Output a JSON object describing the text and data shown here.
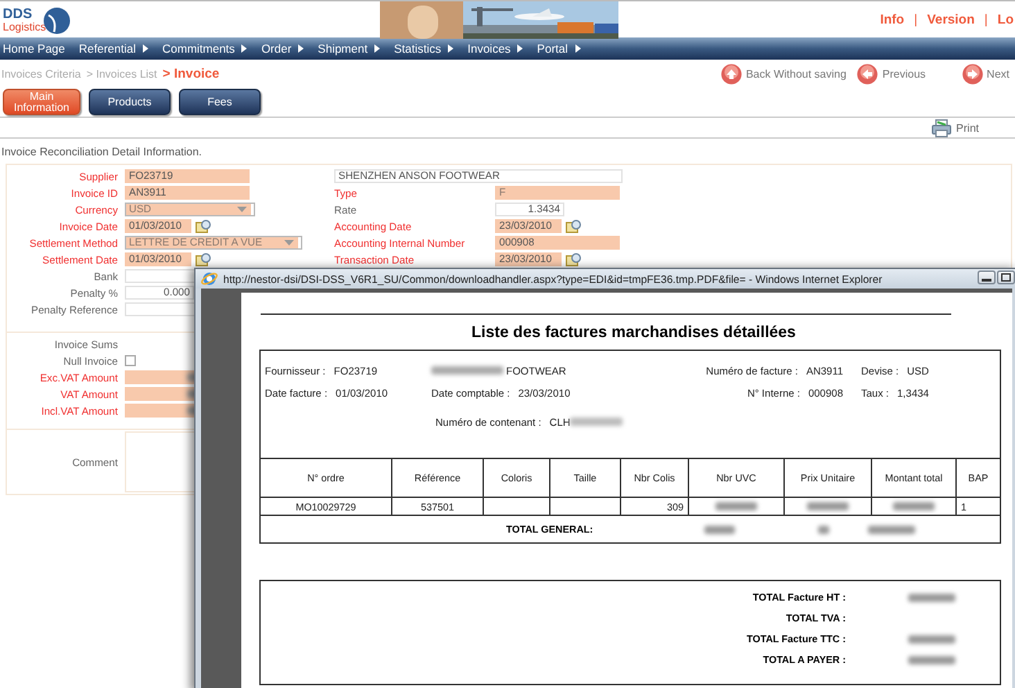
{
  "logo": {
    "title": "DDS",
    "subtitle": "Logistics"
  },
  "header_links": [
    {
      "kind": "link",
      "text": "Info"
    },
    {
      "kind": "separator",
      "text": "|"
    },
    {
      "kind": "link",
      "text": "Version"
    },
    {
      "kind": "separator",
      "text": "|"
    },
    {
      "kind": "link",
      "text": "Lo"
    }
  ],
  "nav": [
    {
      "label": "Home Page",
      "submenu": false
    },
    {
      "label": "Referential",
      "submenu": true
    },
    {
      "label": "Commitments",
      "submenu": true
    },
    {
      "label": "Order",
      "submenu": true
    },
    {
      "label": "Shipment",
      "submenu": true
    },
    {
      "label": "Statistics",
      "submenu": true
    },
    {
      "label": "Invoices",
      "submenu": true
    },
    {
      "label": "Portal",
      "submenu": true
    }
  ],
  "breadcrumb": [
    {
      "kind": "link",
      "text": "Invoices Criteria"
    },
    {
      "kind": "link",
      "text": "> Invoices List"
    },
    {
      "kind": "current",
      "text": "> Invoice"
    }
  ],
  "actions": [
    {
      "label": "Back Without saving",
      "kind": "up"
    },
    {
      "label": "Previous",
      "kind": "left"
    },
    {
      "label": "Next",
      "kind": "right"
    }
  ],
  "tabs": [
    {
      "label": "Main Information",
      "selected": true
    },
    {
      "label": "Products",
      "selected": false
    },
    {
      "label": "Fees",
      "selected": false
    }
  ],
  "toolbar": {
    "print": "Print"
  },
  "intro": "Invoice Reconciliation Detail Information.",
  "left_fields": [
    {
      "label": "Supplier",
      "required": true,
      "kind": "text",
      "value": "FO23719",
      "disabled": false
    },
    {
      "label": "Invoice ID",
      "required": true,
      "kind": "text",
      "value": "AN3911",
      "disabled": false
    },
    {
      "label": "Currency",
      "required": true,
      "kind": "select",
      "value": "USD",
      "disabled": true
    },
    {
      "label": "Invoice Date",
      "required": true,
      "kind": "date",
      "value": "01/03/2010",
      "disabled": false
    },
    {
      "label": "Settlement Method",
      "required": true,
      "kind": "select",
      "value": "LETTRE DE CREDIT A VUE",
      "disabled": true
    },
    {
      "label": "Settlement Date",
      "required": true,
      "kind": "date",
      "value": "01/03/2010",
      "disabled": false
    },
    {
      "label": "Bank",
      "required": false,
      "kind": "text",
      "disabled": false
    },
    {
      "label": "Penalty %",
      "required": false,
      "kind": "number",
      "value": "0.000",
      "disabled": false
    },
    {
      "label": "Penalty Reference",
      "required": false,
      "kind": "text",
      "disabled": false
    }
  ],
  "right_fields": [
    {
      "required": false,
      "kind": "text",
      "value": "SHENZHEN ANSON FOOTWEAR",
      "disabled": false
    },
    {
      "label": "Type",
      "required": true,
      "kind": "text",
      "value": "F",
      "disabled": true
    },
    {
      "label": "Rate",
      "required": false,
      "kind": "number",
      "value": "1.3434",
      "disabled": false
    },
    {
      "label": "Accounting Date",
      "required": true,
      "kind": "date",
      "value": "23/03/2010",
      "disabled": false
    },
    {
      "label": "Accounting Internal Number",
      "required": true,
      "kind": "text",
      "value": "000908",
      "disabled": false
    },
    {
      "label": "Transaction Date",
      "required": true,
      "kind": "date",
      "value": "23/03/2010",
      "disabled": false
    }
  ],
  "sums": {
    "title": "Invoice Sums",
    "null_invoice": {
      "label": "Null Invoice",
      "checked": false
    },
    "amounts": [
      {
        "label": "Exc.VAT Amount",
        "required": true,
        "redacted": true
      },
      {
        "label": "VAT Amount",
        "required": true,
        "redacted": true
      },
      {
        "label": "Incl.VAT Amount",
        "required": true,
        "redacted": true
      }
    ],
    "comment": {
      "label": "Comment"
    }
  },
  "popup": {
    "title": "http://nestor-dsi/DSI-DSS_V6R1_SU/Common/downloadhandler.aspx?type=EDI&id=tmpFE36.tmp.PDF&file= - Windows Internet Explorer",
    "document": {
      "title": "Liste des factures marchandises détaillées",
      "info_rows": [
        [
          {
            "label": "Fournisseur :",
            "value": "FO23719",
            "redacted": false
          },
          {
            "value": "FOOTWEAR",
            "redacted": true
          },
          {
            "label": "Numéro de facture :",
            "value": "AN3911",
            "redacted": false
          },
          {
            "label": "Devise :",
            "value": "USD",
            "redacted": false
          }
        ],
        [
          {
            "label": "Date facture :",
            "value": "01/03/2010",
            "redacted": false
          },
          {
            "label": "Date comptable :",
            "value": "23/03/2010",
            "redacted": false
          },
          {
            "label": "N° Interne :",
            "value": "000908",
            "redacted": false
          },
          {
            "label": "Taux :",
            "value": "1,3434",
            "redacted": false
          }
        ],
        [
          {
            "label": "Numéro de contenant :",
            "value": "CLH",
            "redacted": true
          }
        ]
      ],
      "columns": [
        "N° ordre",
        "Référence",
        "Coloris",
        "Taille",
        "Nbr Colis",
        "Nbr UVC",
        "Prix Unitaire",
        "Montant total",
        "BAP"
      ],
      "rows": [
        [
          {
            "kind": "text",
            "text": "MO10029729"
          },
          {
            "kind": "text",
            "text": "537501"
          },
          {
            "kind": "empty"
          },
          {
            "kind": "empty"
          },
          {
            "kind": "number",
            "text": "309"
          },
          {
            "kind": "redacted"
          },
          {
            "kind": "redacted"
          },
          {
            "kind": "redacted"
          },
          {
            "kind": "left",
            "text": "1"
          }
        ]
      ],
      "total_general": "TOTAL GENERAL:",
      "totals": [
        {
          "label": "TOTAL Facture HT :",
          "redacted": true
        },
        {
          "label": "TOTAL TVA :",
          "redacted": false
        },
        {
          "label": "TOTAL Facture TTC :",
          "redacted": true
        },
        {
          "label": "TOTAL A PAYER :",
          "redacted": true
        }
      ]
    }
  }
}
